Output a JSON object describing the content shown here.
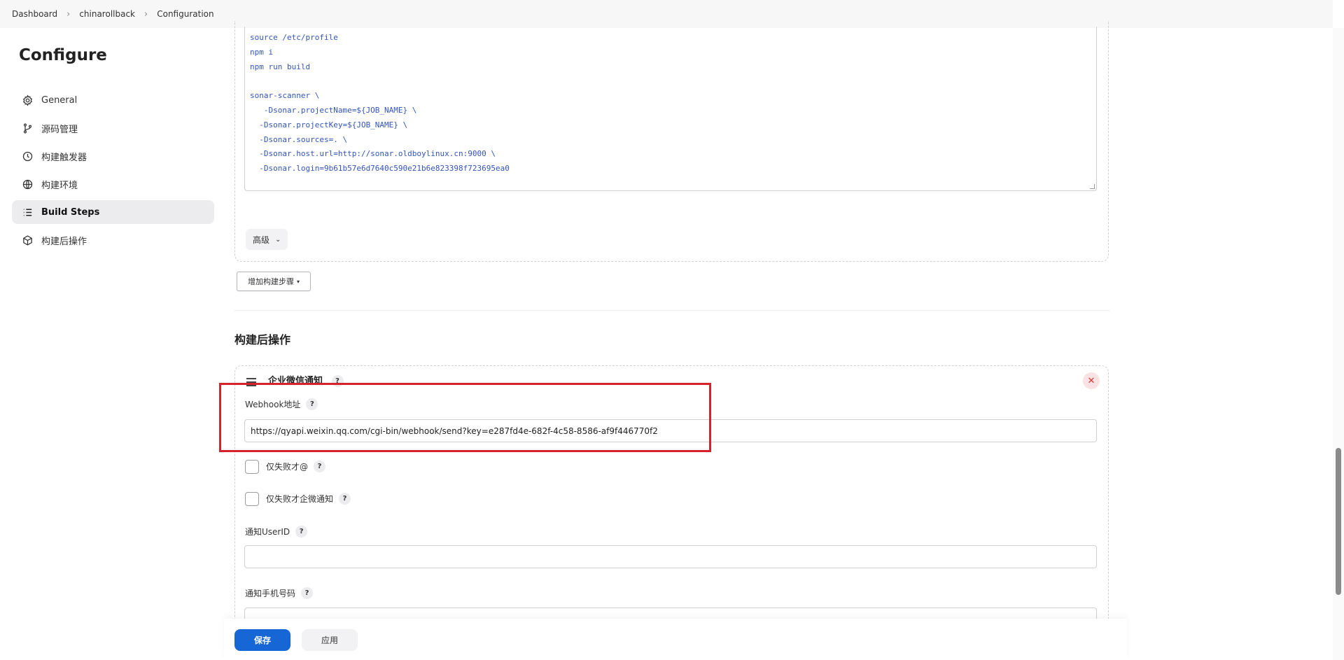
{
  "breadcrumb": [
    "Dashboard",
    "chinarollback",
    "Configuration"
  ],
  "sidebar": {
    "title": "Configure",
    "items": [
      {
        "label": "General",
        "icon": "gear-icon"
      },
      {
        "label": "源码管理",
        "icon": "branch-icon"
      },
      {
        "label": "构建触发器",
        "icon": "clock-icon"
      },
      {
        "label": "构建环境",
        "icon": "globe-icon"
      },
      {
        "label": "Build Steps",
        "icon": "list-icon",
        "active": true
      },
      {
        "label": "构建后操作",
        "icon": "cube-icon"
      }
    ]
  },
  "script": {
    "lines": [
      "source /etc/profile",
      "npm i",
      "npm run build",
      "",
      "sonar-scanner \\",
      "   -Dsonar.projectName=${JOB_NAME} \\",
      "  -Dsonar.projectKey=${JOB_NAME} \\",
      "  -Dsonar.sources=. \\",
      "  -Dsonar.host.url=http://sonar.oldboylinux.cn:9000 \\",
      "  -Dsonar.login=9b61b57e6d7640c590e21b6e823398f723695ea0"
    ]
  },
  "advanced_label": "高级",
  "add_step_label": "增加构建步骤",
  "post_build": {
    "section_title": "构建后操作",
    "card_title": "企业微信通知",
    "webhook_label": "Webhook地址",
    "webhook_value": "https://qyapi.weixin.qq.com/cgi-bin/webhook/send?key=e287fd4e-682f-4c58-8586-af9f446770f2",
    "checkbox1_label": "仅失败才@",
    "checkbox2_label": "仅失败才企微通知",
    "userid_label": "通知UserID",
    "userid_value": "",
    "phone_label": "通知手机号码",
    "phone_value": "",
    "help_mark": "?"
  },
  "footer": {
    "save_label": "保存",
    "apply_label": "应用"
  },
  "colors": {
    "primary": "#1766d6",
    "highlight": "#d6222a",
    "active_nav": "#ececef"
  }
}
